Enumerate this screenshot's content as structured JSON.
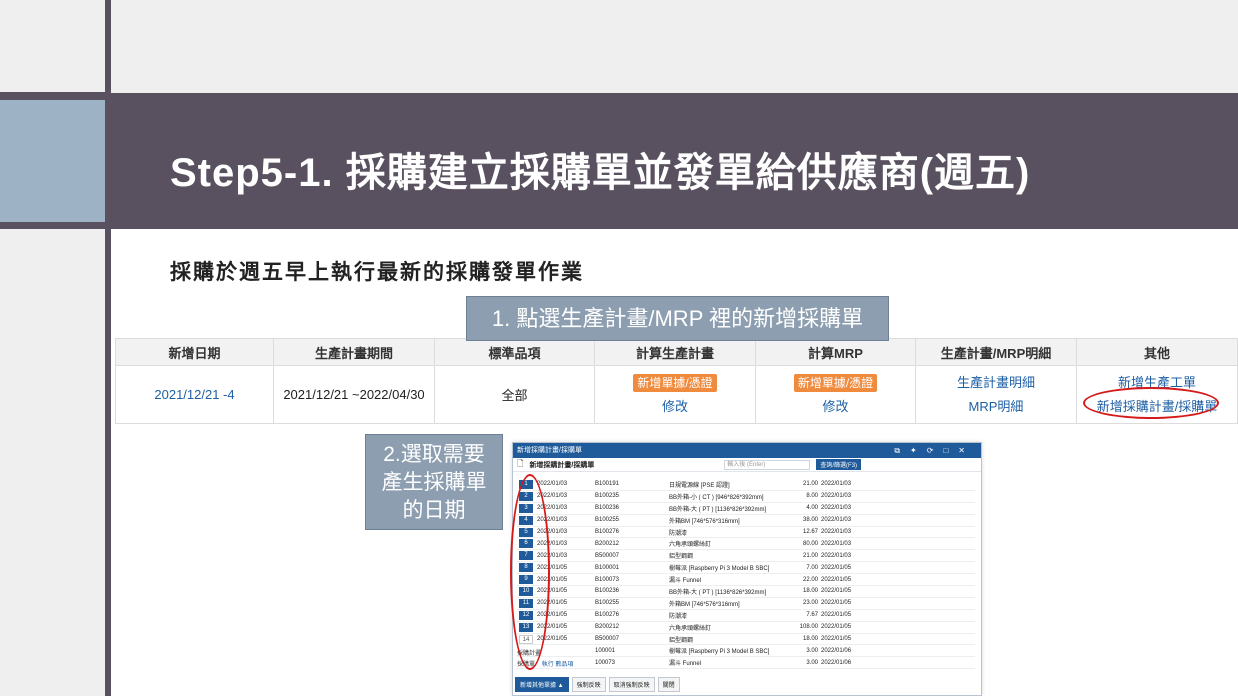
{
  "slide": {
    "title": "Step5-1. 採購建立採購單並發單給供應商(週五)",
    "subtitle": "採購於週五早上執行最新的採購發單作業",
    "callout1": "1. 點選生產計畫/MRP 裡的新增採購單",
    "callout2_lines": [
      "2.選取需要",
      "產生採購單",
      "的日期"
    ]
  },
  "colors": {
    "title_band": "#5a5160",
    "accent": "#9eb2c6",
    "callout": "#8c9eb0",
    "link": "#1d5fa5",
    "orange": "#f08a3c",
    "highlight": "#d61a1a"
  },
  "mrp_table": {
    "headers": [
      "新增日期",
      "生產計畫期間",
      "標準品項",
      "計算生產計畫",
      "計算MRP",
      "生產計畫/MRP明細",
      "其他"
    ],
    "row": {
      "date": "2021/12/21 -4",
      "period": "2021/12/21 ~2022/04/30",
      "standard": "全部",
      "plan_new": "新增單據/憑證",
      "plan_edit": "修改",
      "mrp_new": "新增單據/憑證",
      "mrp_edit": "修改",
      "plan_detail": "生產計畫明細",
      "mrp_detail": "MRP明細",
      "other_new_work": "新增生產工單",
      "other_new_purchase": "新增採購計畫/採購單"
    }
  },
  "panel": {
    "window_title": "新增採購計畫/採購單",
    "toolbar_title": "新增採購計畫/採購單",
    "search_placeholder": "輸入後 (Enter)",
    "query_button": "查詢/篩選(F3)",
    "rows": [
      {
        "n": "1",
        "date": "2022/01/03",
        "code": "B100191",
        "name": "日規電源線 [PSE 認證]",
        "qty": "21.00",
        "due": "2022/01/03"
      },
      {
        "n": "2",
        "date": "2022/01/03",
        "code": "B100235",
        "name": "BB外箱-小 ( CT ) [946*826*392mm]",
        "qty": "8.00",
        "due": "2022/01/03"
      },
      {
        "n": "3",
        "date": "2022/01/03",
        "code": "B100236",
        "name": "BB外箱-大 ( PT ) [1136*826*392mm]",
        "qty": "4.00",
        "due": "2022/01/03"
      },
      {
        "n": "4",
        "date": "2022/01/03",
        "code": "B100255",
        "name": "外箱BM [746*576*316mm]",
        "qty": "38.00",
        "due": "2022/01/03"
      },
      {
        "n": "5",
        "date": "2022/01/03",
        "code": "B100276",
        "name": "防潮漆",
        "qty": "12.67",
        "due": "2022/01/03"
      },
      {
        "n": "6",
        "date": "2022/01/03",
        "code": "B200212",
        "name": "六角承頭螺絲釘",
        "qty": "80.00",
        "due": "2022/01/03"
      },
      {
        "n": "7",
        "date": "2022/01/03",
        "code": "B500007",
        "name": "鋁型鋼鋼",
        "qty": "21.00",
        "due": "2022/01/03"
      },
      {
        "n": "8",
        "date": "2022/01/05",
        "code": "B100001",
        "name": "樹莓派 [Raspberry Pi 3 Model B SBC]",
        "qty": "7.00",
        "due": "2022/01/05"
      },
      {
        "n": "9",
        "date": "2022/01/05",
        "code": "B100073",
        "name": "漏斗 Funnel",
        "qty": "22.00",
        "due": "2022/01/05"
      },
      {
        "n": "10",
        "date": "2022/01/05",
        "code": "B100236",
        "name": "BB外箱-大 ( PT ) [1136*826*392mm]",
        "qty": "18.00",
        "due": "2022/01/05"
      },
      {
        "n": "11",
        "date": "2022/01/05",
        "code": "B100255",
        "name": "外箱BM [746*576*316mm]",
        "qty": "23.00",
        "due": "2022/01/05"
      },
      {
        "n": "12",
        "date": "2022/01/05",
        "code": "B100276",
        "name": "防潮漆",
        "qty": "7.67",
        "due": "2022/01/05"
      },
      {
        "n": "13",
        "date": "2022/01/05",
        "code": "B200212",
        "name": "六角承頭螺絲釘",
        "qty": "108.00",
        "due": "2022/01/05"
      },
      {
        "n": "14",
        "date": "2022/01/05",
        "code": "B500007",
        "name": "鋁型鋼鋼",
        "qty": "18.00",
        "due": "2022/01/05"
      },
      {
        "n": "",
        "date": "",
        "code": "100001",
        "name": "樹莓派 [Raspberry Pi 3 Model B SBC]",
        "qty": "3.00",
        "due": "2022/01/06"
      },
      {
        "n": "",
        "date": "",
        "code": "100073",
        "name": "漏斗 Funnel",
        "qty": "3.00",
        "due": "2022/01/06"
      }
    ],
    "bottom_label1": "採購計畫",
    "bottom_label2": "採購單",
    "bottom_link1": "執行",
    "bottom_link2": "數品項",
    "footer_buttons": [
      "新增其他單據 ▲",
      "強制反映",
      "取消強制反映",
      "關閉"
    ]
  }
}
